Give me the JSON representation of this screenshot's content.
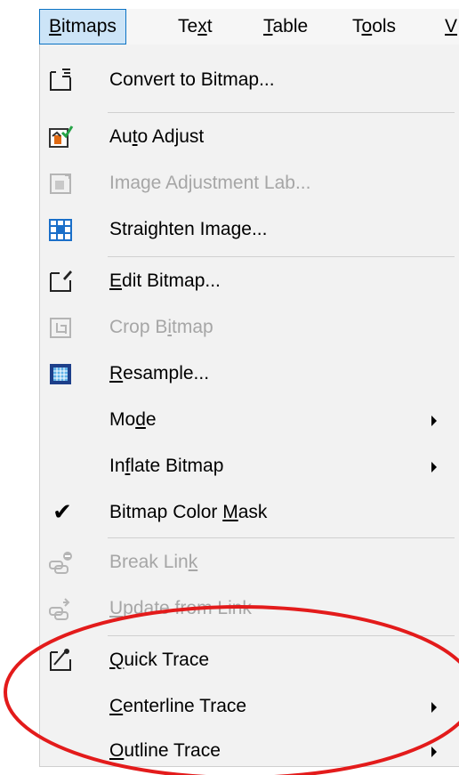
{
  "menubar": {
    "items": [
      {
        "pre": "",
        "u": "B",
        "post": "itmaps"
      },
      {
        "pre": "Te",
        "u": "x",
        "post": "t"
      },
      {
        "pre": "",
        "u": "T",
        "post": "able"
      },
      {
        "pre": "T",
        "u": "o",
        "post": "ols"
      },
      {
        "pre": "",
        "u": "V",
        "post": ""
      }
    ]
  },
  "menu": {
    "items": [
      {
        "pre": "Convert to Bitmap",
        "u": "",
        "post": "...",
        "icon": "convert-to-bitmap-icon",
        "disabled": false
      },
      {
        "pre": "Au",
        "u": "t",
        "post": "o Adjust",
        "icon": "auto-adjust-icon",
        "disabled": false
      },
      {
        "pre": "Image Adjustment Lab...",
        "u": "",
        "post": "",
        "icon": "image-adjustment-lab-icon",
        "disabled": true
      },
      {
        "pre": "Strai",
        "u": "g",
        "post": "hten Image...",
        "icon": "straighten-image-icon",
        "disabled": false
      },
      {
        "pre": "",
        "u": "E",
        "post": "dit Bitmap...",
        "icon": "edit-bitmap-icon",
        "disabled": false
      },
      {
        "pre": "Crop B",
        "u": "i",
        "post": "tmap",
        "icon": "crop-bitmap-icon",
        "disabled": true
      },
      {
        "pre": "",
        "u": "R",
        "post": "esample...",
        "icon": "resample-icon",
        "disabled": false
      },
      {
        "pre": "Mo",
        "u": "d",
        "post": "e",
        "icon": "",
        "disabled": false,
        "submenu": true
      },
      {
        "pre": "In",
        "u": "f",
        "post": "late Bitmap",
        "icon": "",
        "disabled": false,
        "submenu": true
      },
      {
        "pre": "Bitmap Color ",
        "u": "M",
        "post": "ask",
        "icon": "checkmark-icon",
        "disabled": false,
        "checked": true
      },
      {
        "pre": "Break Lin",
        "u": "k",
        "post": "",
        "icon": "break-link-icon",
        "disabled": true
      },
      {
        "pre": "",
        "u": "U",
        "post": "pdate from Link",
        "icon": "update-from-link-icon",
        "disabled": true
      },
      {
        "pre": "",
        "u": "Q",
        "post": "uick Trace",
        "icon": "quick-trace-icon",
        "disabled": false
      },
      {
        "pre": "",
        "u": "C",
        "post": "enterline Trace",
        "icon": "",
        "disabled": false,
        "submenu": true
      },
      {
        "pre": "",
        "u": "O",
        "post": "utline Trace",
        "icon": "",
        "disabled": false,
        "submenu": true
      }
    ]
  },
  "annotation": {
    "color": "#e31b1b"
  }
}
